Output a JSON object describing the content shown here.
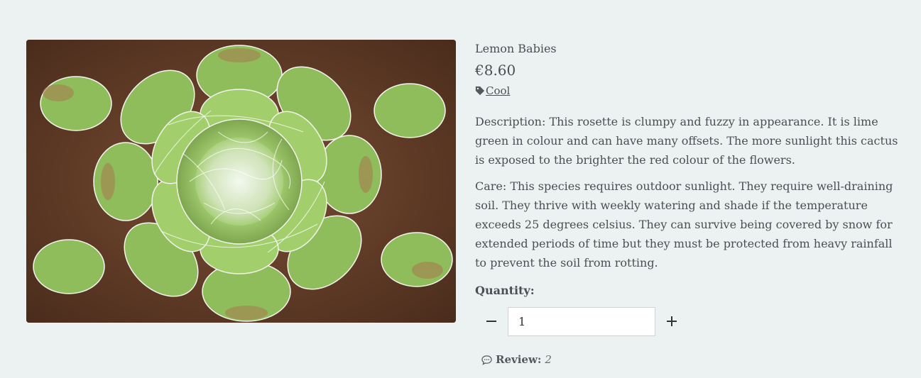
{
  "product": {
    "name": "Lemon Babies",
    "price": "€8.60",
    "tag_label": "Cool",
    "description": "Description: This rosette is clumpy and fuzzy in appearance. It is lime green in colour and can have many offsets. The more sunlight this cactus is exposed to the brighter the red colour of the flowers.",
    "care": "Care: This species requires outdoor sunlight. They require well-draining soil. They thrive with weekly watering and shade if the temperature exceeds 25 degrees celsius. They can survive being covered by snow for extended periods of time but they must be protected from heavy rainfall to prevent the soil from rotting.",
    "image_icon": "succulent-photo"
  },
  "quantity": {
    "label": "Quantity:",
    "value": "1",
    "decrement_icon": "minus-icon",
    "increment_icon": "plus-icon"
  },
  "review": {
    "label": "Review:",
    "count": "2",
    "icon": "comment-icon"
  },
  "colors": {
    "background": "#ecf1f1",
    "text": "#4b4f54",
    "leaf_light": "#9cc96a",
    "leaf_dark": "#6f9a45",
    "soil": "#5a3a26"
  }
}
